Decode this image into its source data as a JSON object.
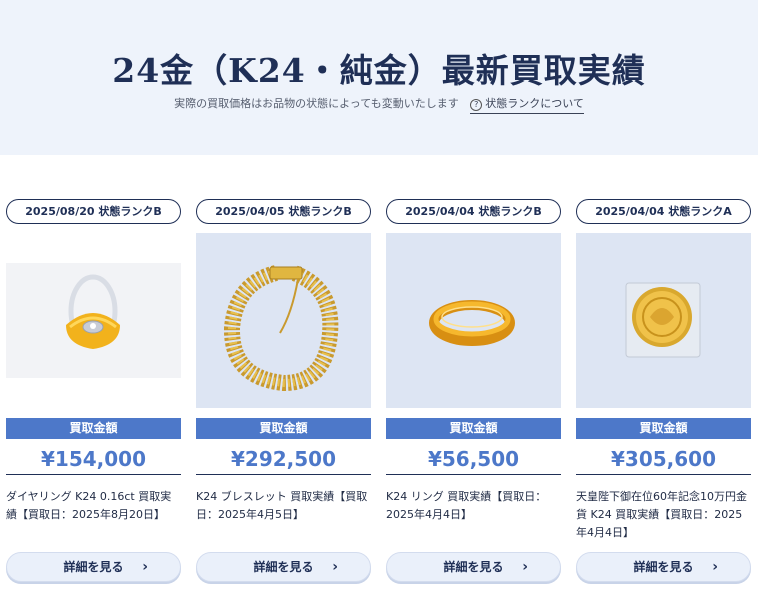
{
  "hero": {
    "title": "24金（K24・純金）最新買取実績",
    "subtitle": "実際の買取価格はお品物の状態によっても変動いたします",
    "rank_link": "状態ランクについて"
  },
  "price_label": "買取金額",
  "cards": [
    {
      "date_rank": "2025/08/20  状態ランクB",
      "price": "¥154,000",
      "description": "ダイヤリング K24 0.16ct 買取実績【買取日：2025年8月20日】",
      "button": "詳細を見る"
    },
    {
      "date_rank": "2025/04/05  状態ランクB",
      "price": "¥292,500",
      "description": "K24 ブレスレット 買取実績【買取日：2025年4月5日】",
      "button": "詳細を見る"
    },
    {
      "date_rank": "2025/04/04  状態ランクB",
      "price": "¥56,500",
      "description": "K24 リング 買取実績【買取日：2025年4月4日】",
      "button": "詳細を見る"
    },
    {
      "date_rank": "2025/04/04  状態ランクA",
      "price": "¥305,600",
      "description": "天皇陛下御在位60年記念10万円金貨 K24 買取実績【買取日：2025年4月4日】",
      "button": "詳細を見る"
    }
  ],
  "colors": {
    "accent": "#4d78c9",
    "navy": "#1f2f56",
    "hero_bg": "#eef3fb"
  }
}
